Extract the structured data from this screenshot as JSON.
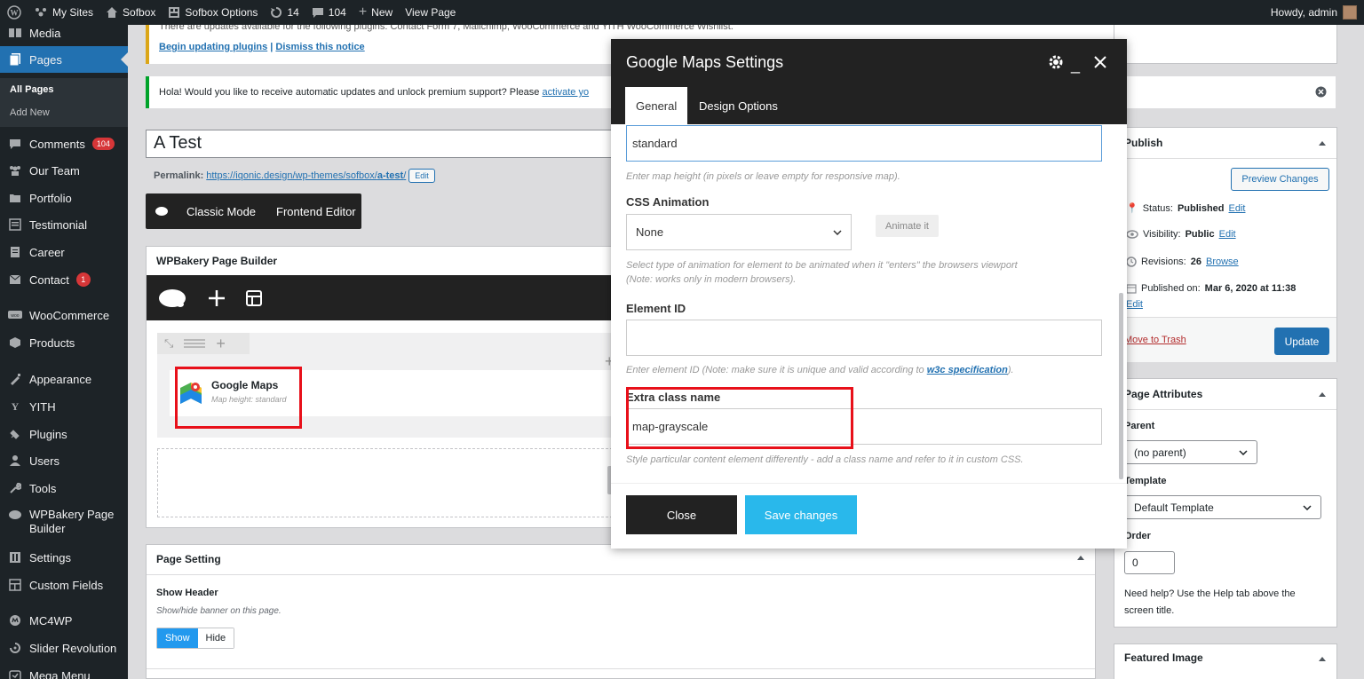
{
  "admin_bar": {
    "my_sites": "My Sites",
    "site_name": "Sofbox",
    "options": "Sofbox Options",
    "updates_count": "14",
    "comments_count": "104",
    "new_label": "New",
    "view_page": "View Page",
    "howdy": "Howdy, admin"
  },
  "sidebar": {
    "items": [
      {
        "label": "Media",
        "icon": "media-icon"
      },
      {
        "label": "Pages",
        "icon": "pages-icon"
      },
      {
        "label": "Comments",
        "icon": "comments-icon",
        "badge": "104"
      },
      {
        "label": "Our Team",
        "icon": "team-icon"
      },
      {
        "label": "Portfolio",
        "icon": "portfolio-icon"
      },
      {
        "label": "Testimonial",
        "icon": "testimonial-icon"
      },
      {
        "label": "Career",
        "icon": "career-icon"
      },
      {
        "label": "Contact",
        "icon": "contact-icon",
        "badge": "1"
      },
      {
        "label": "WooCommerce",
        "icon": "woocommerce-icon"
      },
      {
        "label": "Products",
        "icon": "products-icon"
      },
      {
        "label": "Appearance",
        "icon": "appearance-icon"
      },
      {
        "label": "YITH",
        "icon": "yith-icon"
      },
      {
        "label": "Plugins",
        "icon": "plugins-icon"
      },
      {
        "label": "Users",
        "icon": "users-icon"
      },
      {
        "label": "Tools",
        "icon": "tools-icon"
      },
      {
        "label": "WPBakery Page",
        "label2": "Builder",
        "icon": "wpbakery-icon"
      },
      {
        "label": "Settings",
        "icon": "settings-icon"
      },
      {
        "label": "Custom Fields",
        "icon": "custom-fields-icon"
      },
      {
        "label": "MC4WP",
        "icon": "mc4wp-icon"
      },
      {
        "label": "Slider Revolution",
        "icon": "slider-icon"
      },
      {
        "label": "Mega Menu",
        "icon": "mega-menu-icon"
      }
    ],
    "sub_all_pages": "All Pages",
    "sub_add_new": "Add New"
  },
  "notices": {
    "update_text": "There are updates available for the following plugins: Contact Form 7, Mailchimp, WooCommerce and YITH WooCommerce Wishlist.",
    "begin_updating": "Begin updating plugins",
    "separator": "|",
    "dismiss": "Dismiss this notice",
    "hola_text": "Hola! Would you like to receive automatic updates and unlock premium support? Please",
    "activate": "activate yo"
  },
  "editor": {
    "title": "A Test",
    "permalink_label": "Permalink:",
    "permalink_base": "https://iqonic.design/wp-themes/sofbox/",
    "permalink_slug": "a-test",
    "permalink_end": "/",
    "edit_btn": "Edit",
    "classic_mode": "Classic Mode",
    "frontend_editor": "Frontend Editor",
    "builder_title": "WPBakery Page Builder",
    "element_name": "Google Maps",
    "element_desc": "Map height: standard"
  },
  "page_setting": {
    "title": "Page Setting",
    "show_header_label": "Show Header",
    "show_header_desc": "Show/hide banner on this page.",
    "show": "Show",
    "hide": "Hide"
  },
  "modal": {
    "title": "Google Maps Settings",
    "tabs": [
      "General",
      "Design Options"
    ],
    "height_value": "standard",
    "height_desc": "Enter map height (in pixels or leave empty for responsive map).",
    "css_anim_label": "CSS Animation",
    "css_anim_value": "None",
    "animate_btn": "Animate it",
    "css_anim_desc1": "Select type of animation for element to be animated when it \"enters\" the browsers viewport",
    "css_anim_desc2": "(Note: works only in modern browsers).",
    "element_id_label": "Element ID",
    "element_id_value": "",
    "element_id_desc": "Enter element ID (Note: make sure it is unique and valid according to",
    "w3c_link": "w3c specification",
    "element_id_desc_end": ").",
    "extra_class_label": "Extra class name",
    "extra_class_value": "map-grayscale",
    "extra_class_desc": "Style particular content element differently - add a class name and refer to it in custom CSS.",
    "close_btn": "Close",
    "save_btn": "Save changes"
  },
  "publish": {
    "title": "Publish",
    "preview": "Preview Changes",
    "status_label": "Status:",
    "status_value": "Published",
    "visibility_label": "Visibility:",
    "visibility_value": "Public",
    "revisions_label": "Revisions:",
    "revisions_value": "26",
    "browse": "Browse",
    "published_on_label": "Published on:",
    "published_on_value": "Mar 6, 2020 at 11:38",
    "edit": "Edit",
    "move_trash": "Move to Trash",
    "update": "Update"
  },
  "page_attributes": {
    "title": "Page Attributes",
    "parent_label": "Parent",
    "parent_value": "(no parent)",
    "template_label": "Template",
    "template_value": "Default Template",
    "order_label": "Order",
    "order_value": "0",
    "help": "Need help? Use the Help tab above the",
    "help2": "screen title."
  },
  "featured_image": {
    "title": "Featured Image"
  },
  "colors": {
    "accent": "#2271b1",
    "highlight": "#e8101a",
    "save": "#29b8eb"
  }
}
